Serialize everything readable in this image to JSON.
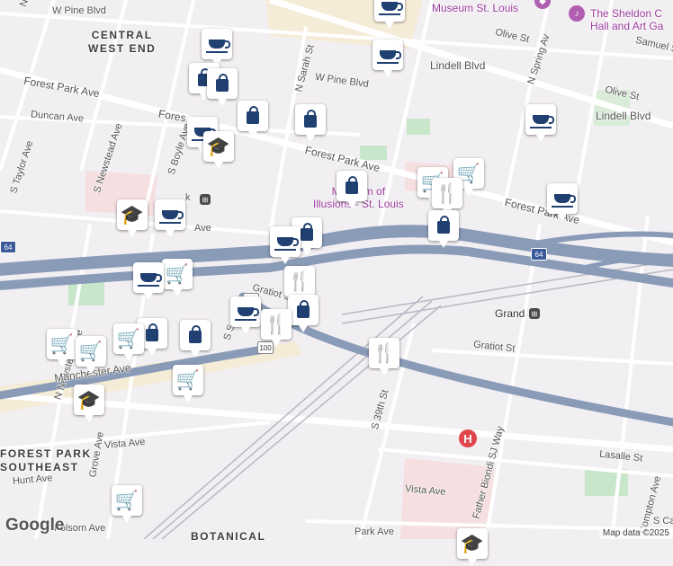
{
  "streets": {
    "w_pine_blvd_top": "W Pine Blvd",
    "n_taylor_ave": "N Taylor Ave",
    "olive_st": "Olive St",
    "n_spring_av": "N Spring Av",
    "samuel_s": "Samuel S",
    "lindell_blvd_n": "Lindell Blvd",
    "w_pine_blvd": "W Pine Blvd",
    "n_sarah_st": "N Sarah St",
    "olive_st_2": "Olive St",
    "lindell_blvd_e": "Lindell Blvd",
    "forest_park_ave_w": "Forest Park Ave",
    "forest_w": "Fores",
    "duncan_ave": "Duncan Ave",
    "s_taylor_ave": "S Taylor Ave",
    "s_newstead_ave": "S Newstead Ave",
    "s_boyle_ave": "S Boyle Ave",
    "forest_park_ave_mid": "Forest Park Ave",
    "forest_park_ave_e": "Forest Park Ave",
    "k_fragment": "k",
    "ave_fragment": "Ave",
    "gratiot_st_w": "Gratiot St",
    "gratiot_st_e": "Gratiot St",
    "s_s_fragment": "S S",
    "n_newstead_ave": "N Newstead Ave",
    "manchester_ave": "Manchester Ave",
    "grove_ave": "Grove Ave",
    "vista_ave_w": "Vista Ave",
    "vista_ave_e": "Vista Ave",
    "hunt_ave": "Hunt Ave",
    "s_39th_st": "S 39th St",
    "father_biondi_sj_way": "Father Biondi SJ Way",
    "lasalle_st": "Lasalle St",
    "compton_ave": "Compton Ave",
    "folsom_ave": "Folsom Ave",
    "park_ave": "Park Ave",
    "s_ca_fragment": "S Ca"
  },
  "districts": {
    "central_west_end": "CENTRAL\nWEST END",
    "forest_park_southeast": "FOREST PARK\nSOUTHEAST",
    "botanical": "BOTANICAL"
  },
  "pois": {
    "museum_st_louis": "Museum St. Louis",
    "sheldon": "The Sheldon C\nHall and Art Ga",
    "museum_of_illusions": "Museum of\nIllusions - St. Louis",
    "grand": "Grand"
  },
  "shields": {
    "i64_w": "64",
    "i64_e": "64",
    "route_100_a": "100",
    "route_100_b": "100"
  },
  "markers": {
    "shopping": "shopping",
    "cafe": "cafe",
    "grocery": "grocery",
    "restaurant": "restaurant",
    "school": "school"
  },
  "footer": {
    "google": "Google",
    "map_data": "Map data ©2025"
  },
  "colors": {
    "background": "#f2eff3",
    "highway": "#8a9bb8",
    "arterial": "#ffffff",
    "park": "#c8e6c9",
    "commercial": "#f5ecd7",
    "medical": "#f6dfe0",
    "marker_icon": "#1f4070"
  }
}
